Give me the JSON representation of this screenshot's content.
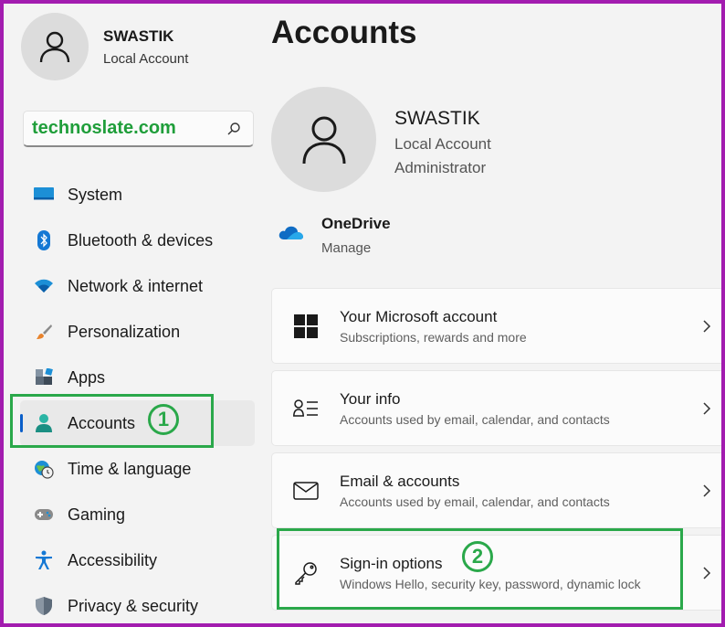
{
  "sidebar": {
    "profile": {
      "name": "SWASTIK",
      "type": "Local Account",
      "avatar_icon": "person-icon"
    },
    "search": {
      "value": "technoslate.com",
      "icon": "search-icon"
    },
    "items": [
      {
        "label": "System",
        "icon": "monitor-icon"
      },
      {
        "label": "Bluetooth & devices",
        "icon": "bluetooth-icon"
      },
      {
        "label": "Network & internet",
        "icon": "wifi-icon"
      },
      {
        "label": "Personalization",
        "icon": "paintbrush-icon"
      },
      {
        "label": "Apps",
        "icon": "apps-icon"
      },
      {
        "label": "Accounts",
        "icon": "account-icon",
        "active": true
      },
      {
        "label": "Time & language",
        "icon": "clock-globe-icon"
      },
      {
        "label": "Gaming",
        "icon": "gamepad-icon"
      },
      {
        "label": "Accessibility",
        "icon": "accessibility-icon"
      },
      {
        "label": "Privacy & security",
        "icon": "shield-icon"
      }
    ]
  },
  "annotations": {
    "step1": "1",
    "step2": "2",
    "highlight_color": "#2aa84a"
  },
  "main": {
    "title": "Accounts",
    "user": {
      "name": "SWASTIK",
      "type": "Local Account",
      "role": "Administrator"
    },
    "onedrive": {
      "title": "OneDrive",
      "action": "Manage"
    },
    "cards": [
      {
        "title": "Your Microsoft account",
        "subtitle": "Subscriptions, rewards and more",
        "icon": "windows-logo-icon"
      },
      {
        "title": "Your info",
        "subtitle": "Accounts used by email, calendar, and contacts",
        "icon": "person-list-icon"
      },
      {
        "title": "Email & accounts",
        "subtitle": "Accounts used by email, calendar, and contacts",
        "icon": "mail-icon"
      },
      {
        "title": "Sign-in options",
        "subtitle": "Windows Hello, security key, password, dynamic lock",
        "icon": "key-icon"
      }
    ]
  },
  "colors": {
    "frame": "#a21caf",
    "accent": "#0a5ec9",
    "search_text": "#1f9e3a"
  }
}
